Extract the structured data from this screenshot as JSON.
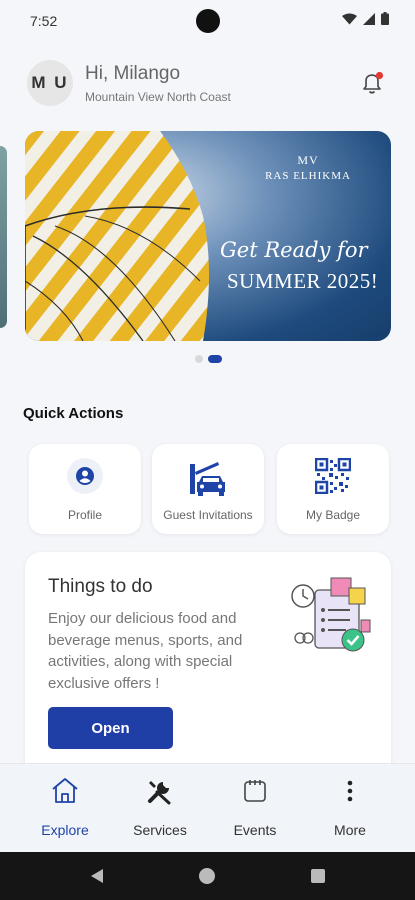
{
  "status_bar": {
    "time": "7:52"
  },
  "header": {
    "avatar_initials": "M U",
    "greeting": "Hi, Milango",
    "location": "Mountain View North Coast"
  },
  "banner": {
    "brand_line1": "MV",
    "brand_line2": "RAS ELHIKMA",
    "tagline": "Get Ready for",
    "headline": "SUMMER 2025!",
    "total_slides": 2,
    "active_slide": 2
  },
  "quick_actions": {
    "title": "Quick Actions",
    "items": [
      {
        "label": "Profile",
        "icon": "profile-icon"
      },
      {
        "label": "Guest Invitations",
        "icon": "car-gate-icon"
      },
      {
        "label": "My Badge",
        "icon": "qr-code-icon"
      }
    ]
  },
  "things_to_do": {
    "title": "Things to do",
    "description": "Enjoy our delicious food and beverage menus, sports, and activities, along with special exclusive offers !",
    "button_label": "Open"
  },
  "bottom_nav": {
    "items": [
      {
        "label": "Explore",
        "icon": "home-icon",
        "active": true
      },
      {
        "label": "Services",
        "icon": "tools-icon",
        "active": false
      },
      {
        "label": "Events",
        "icon": "calendar-icon",
        "active": false
      },
      {
        "label": "More",
        "icon": "more-vertical-icon",
        "active": false
      }
    ]
  },
  "colors": {
    "primary": "#1f3ea6",
    "accent_dot": "#e53935",
    "background": "#f4f6f9"
  }
}
